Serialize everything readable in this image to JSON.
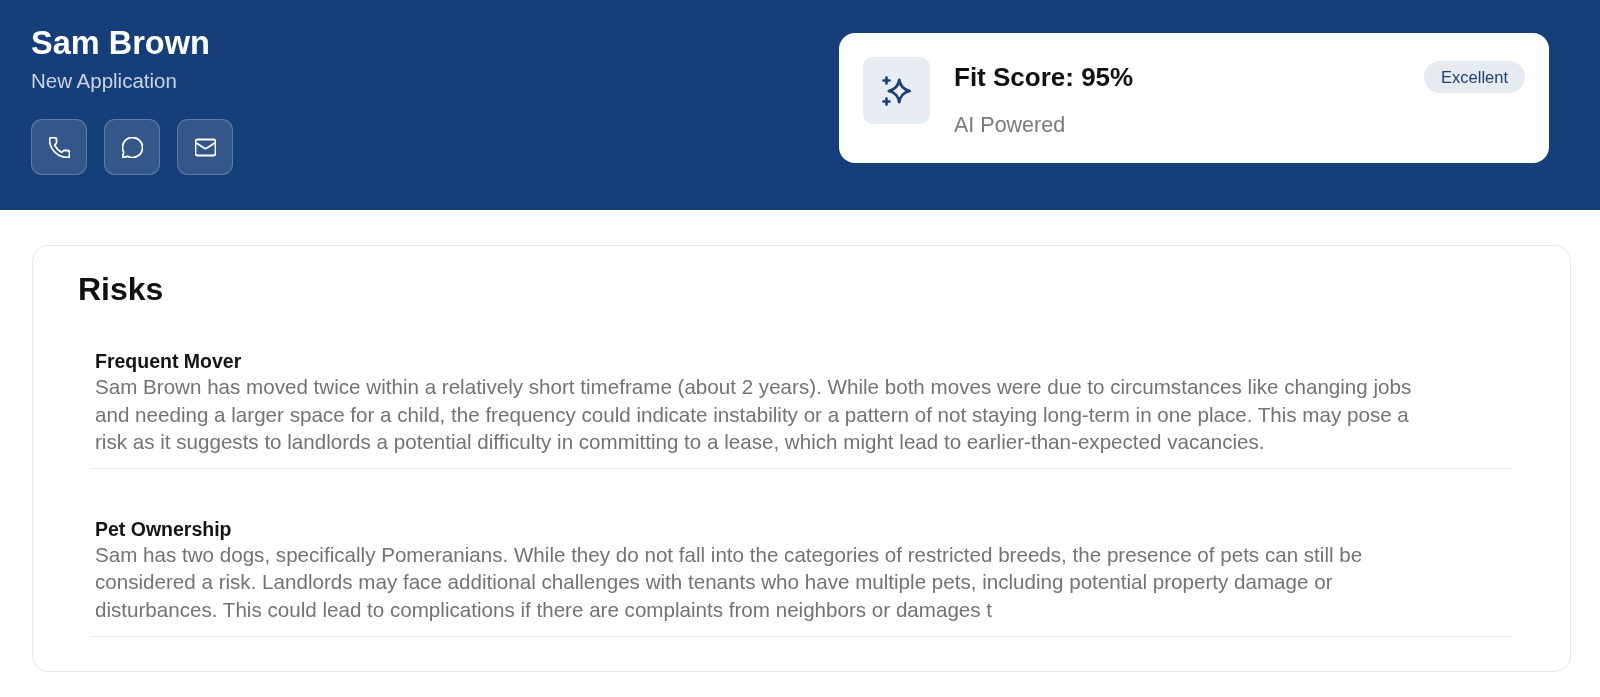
{
  "header": {
    "name": "Sam Brown",
    "subtitle": "New Application"
  },
  "fit_score": {
    "title": "Fit Score: 95%",
    "caption": "AI Powered",
    "badge": "Excellent"
  },
  "risks": {
    "title": "Risks",
    "items": [
      {
        "title": "Frequent Mover",
        "description": "Sam Brown has moved twice within a relatively short timeframe (about 2 years). While both moves were due to circumstances like changing jobs and needing a larger space for a child, the frequency could indicate instability or a pattern of not staying long-term in one place. This may pose a risk as it suggests to landlords a potential difficulty in committing to a lease, which might lead to earlier-than-expected vacancies."
      },
      {
        "title": "Pet Ownership",
        "description": "Sam has two dogs, specifically Pomeranians. While they do not fall into the categories of restricted breeds, the presence of pets can still be considered a risk. Landlords may face additional challenges with tenants who have multiple pets, including potential property damage or disturbances. This could lead to complications if there are complaints from neighbors or damages t"
      }
    ]
  }
}
